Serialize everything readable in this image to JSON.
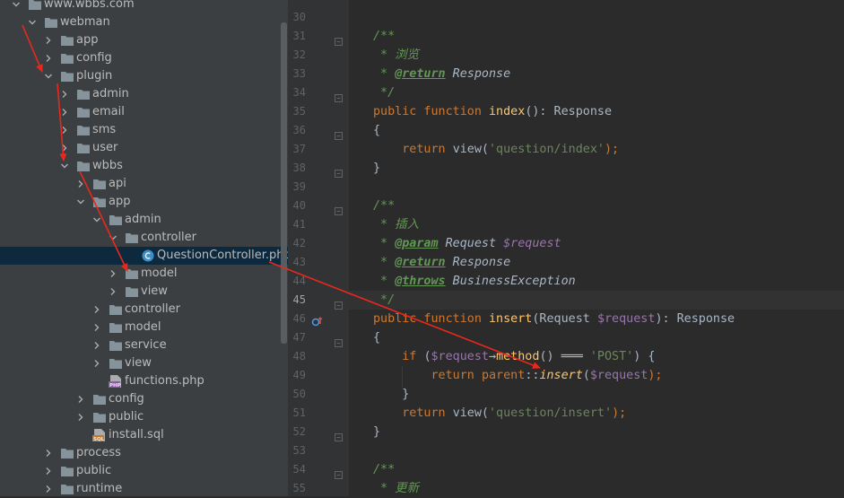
{
  "tree": {
    "items": [
      {
        "label": "www.wbbs.com",
        "type": "folder",
        "expanded": true,
        "level": 0
      },
      {
        "label": "webman",
        "type": "folder",
        "expanded": true,
        "level": 1
      },
      {
        "label": "app",
        "type": "folder",
        "expanded": false,
        "level": 2
      },
      {
        "label": "config",
        "type": "folder",
        "expanded": false,
        "level": 2
      },
      {
        "label": "plugin",
        "type": "folder",
        "expanded": true,
        "level": 2
      },
      {
        "label": "admin",
        "type": "folder",
        "expanded": false,
        "level": 3
      },
      {
        "label": "email",
        "type": "folder",
        "expanded": false,
        "level": 3
      },
      {
        "label": "sms",
        "type": "folder",
        "expanded": false,
        "level": 3
      },
      {
        "label": "user",
        "type": "folder",
        "expanded": false,
        "level": 3
      },
      {
        "label": "wbbs",
        "type": "folder",
        "expanded": true,
        "level": 3
      },
      {
        "label": "api",
        "type": "folder",
        "expanded": false,
        "level": 4
      },
      {
        "label": "app",
        "type": "folder",
        "expanded": true,
        "level": 4
      },
      {
        "label": "admin",
        "type": "folder",
        "expanded": true,
        "level": 5
      },
      {
        "label": "controller",
        "type": "folder",
        "expanded": true,
        "level": 6
      },
      {
        "label": "QuestionController.php",
        "type": "class-file",
        "level": 7,
        "selected": true
      },
      {
        "label": "model",
        "type": "folder",
        "expanded": false,
        "level": 6
      },
      {
        "label": "view",
        "type": "folder",
        "expanded": false,
        "level": 6
      },
      {
        "label": "controller",
        "type": "folder",
        "expanded": false,
        "level": 5
      },
      {
        "label": "model",
        "type": "folder",
        "expanded": false,
        "level": 5
      },
      {
        "label": "service",
        "type": "folder",
        "expanded": false,
        "level": 5
      },
      {
        "label": "view",
        "type": "folder",
        "expanded": false,
        "level": 5
      },
      {
        "label": "functions.php",
        "type": "php-file",
        "level": 5
      },
      {
        "label": "config",
        "type": "folder",
        "expanded": false,
        "level": 4
      },
      {
        "label": "public",
        "type": "folder",
        "expanded": false,
        "level": 4
      },
      {
        "label": "install.sql",
        "type": "sql-file",
        "level": 4
      },
      {
        "label": "process",
        "type": "folder",
        "expanded": false,
        "level": 2
      },
      {
        "label": "public",
        "type": "folder",
        "expanded": false,
        "level": 2
      },
      {
        "label": "runtime",
        "type": "folder",
        "expanded": false,
        "level": 2
      }
    ]
  },
  "editor": {
    "current_line": 45,
    "line_numbers": [
      "30",
      "31",
      "32",
      "33",
      "34",
      "35",
      "36",
      "37",
      "38",
      "39",
      "40",
      "41",
      "42",
      "43",
      "44",
      "45",
      "46",
      "47",
      "48",
      "49",
      "50",
      "51",
      "52",
      "53",
      "54",
      "55"
    ],
    "lines": [
      [
        {
          "t": "",
          "c": ""
        }
      ],
      [
        {
          "t": "/**",
          "c": "doc"
        }
      ],
      [
        {
          "t": " * 浏览",
          "c": "doc"
        }
      ],
      [
        {
          "t": " * ",
          "c": "doc"
        },
        {
          "t": "@return",
          "c": "tag"
        },
        {
          "t": " Response",
          "c": "dtype"
        }
      ],
      [
        {
          "t": " */",
          "c": "doc"
        }
      ],
      [
        {
          "t": "public function ",
          "c": "kw"
        },
        {
          "t": "index",
          "c": "fn"
        },
        {
          "t": "(): Response",
          "c": ""
        }
      ],
      [
        {
          "t": "{",
          "c": ""
        }
      ],
      [
        {
          "t": "    return ",
          "c": "kw"
        },
        {
          "t": "view(",
          "c": ""
        },
        {
          "t": "'question/index'",
          "c": "str"
        },
        {
          "t": ");",
          "c": "kw"
        }
      ],
      [
        {
          "t": "}",
          "c": ""
        }
      ],
      [
        {
          "t": "",
          "c": ""
        }
      ],
      [
        {
          "t": "/**",
          "c": "doc"
        }
      ],
      [
        {
          "t": " * 插入",
          "c": "doc"
        }
      ],
      [
        {
          "t": " * ",
          "c": "doc"
        },
        {
          "t": "@param",
          "c": "tag"
        },
        {
          "t": " Request ",
          "c": "dtype"
        },
        {
          "t": "$request",
          "c": "dvar"
        }
      ],
      [
        {
          "t": " * ",
          "c": "doc"
        },
        {
          "t": "@return",
          "c": "tag"
        },
        {
          "t": " Response",
          "c": "dtype"
        }
      ],
      [
        {
          "t": " * ",
          "c": "doc"
        },
        {
          "t": "@throws",
          "c": "tag"
        },
        {
          "t": " BusinessException",
          "c": "dtype"
        }
      ],
      [
        {
          "t": " */",
          "c": "doc"
        }
      ],
      [
        {
          "t": "public function ",
          "c": "kw"
        },
        {
          "t": "insert",
          "c": "fn"
        },
        {
          "t": "(Request ",
          "c": ""
        },
        {
          "t": "$request",
          "c": "var"
        },
        {
          "t": "): Response",
          "c": ""
        }
      ],
      [
        {
          "t": "{",
          "c": ""
        }
      ],
      [
        {
          "t": "    if ",
          "c": "kw"
        },
        {
          "t": "(",
          "c": ""
        },
        {
          "t": "$request",
          "c": "var"
        },
        {
          "t": "→",
          "c": ""
        },
        {
          "t": "method",
          "c": "fn"
        },
        {
          "t": "() ═══ ",
          "c": ""
        },
        {
          "t": "'POST'",
          "c": "str"
        },
        {
          "t": ") {",
          "c": ""
        }
      ],
      [
        {
          "t": "        return ",
          "c": "kw"
        },
        {
          "t": "parent",
          "c": "kw"
        },
        {
          "t": "::",
          "c": ""
        },
        {
          "t": "insert",
          "c": "fn itl"
        },
        {
          "t": "(",
          "c": ""
        },
        {
          "t": "$request",
          "c": "var"
        },
        {
          "t": ");",
          "c": "kw"
        }
      ],
      [
        {
          "t": "    }",
          "c": ""
        }
      ],
      [
        {
          "t": "    return ",
          "c": "kw"
        },
        {
          "t": "view(",
          "c": ""
        },
        {
          "t": "'question/insert'",
          "c": "str"
        },
        {
          "t": ");",
          "c": "kw"
        }
      ],
      [
        {
          "t": "}",
          "c": ""
        }
      ],
      [
        {
          "t": "",
          "c": ""
        }
      ],
      [
        {
          "t": "/**",
          "c": "doc"
        }
      ],
      [
        {
          "t": " * 更新",
          "c": "doc"
        }
      ]
    ]
  },
  "colors": {
    "annotation_arrow": "#e8281e",
    "folder_icon": "#87939a",
    "class_icon": "#3d8fc6"
  },
  "icons": {
    "expanded": "chevron-down-icon",
    "collapsed": "chevron-right-icon",
    "folder": "folder-icon",
    "class_file": "php-class-icon",
    "php_file": "php-file-icon",
    "sql_file": "sql-file-icon",
    "gutter_marker": "override-method-icon"
  }
}
